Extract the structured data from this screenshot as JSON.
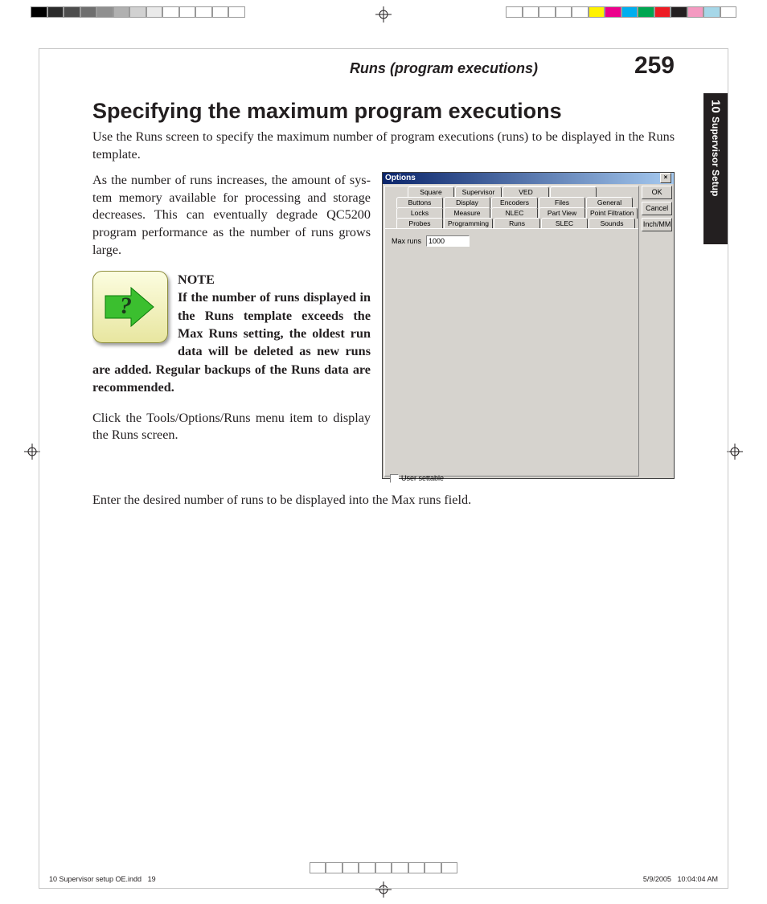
{
  "header": {
    "section": "Runs (program executions)",
    "page": "259"
  },
  "title": "Specifying the maximum program executions",
  "para1": "Use the Runs screen to specify the maximum number of program executions (runs) to be displayed in the Runs template.",
  "para2": "As the number of runs increases, the amount of sys­tem memory available for processing and storage decreases. This can eventually degrade QC5200 program performance as the number of runs grows large.",
  "note": {
    "label": "NOTE",
    "body": "If the number of runs displayed in the Runs template exceeds the Max Runs setting, the oldest run data will be deleted as new runs are added. Regular backups of the Runs data are recommended."
  },
  "para3": "Click the Tools/Options/Runs menu item to display the Runs screen.",
  "para4": "Enter the desired number of runs to be displayed into the Max runs field.",
  "side": {
    "number": "10",
    "name": "Supervisor Setup"
  },
  "dialog": {
    "title": "Options",
    "tabs_row1": [
      "Square",
      "Supervisor",
      "VED",
      ""
    ],
    "tabs_row2": [
      "Buttons",
      "Display",
      "Encoders",
      "Files",
      "General"
    ],
    "tabs_row3": [
      "Locks",
      "Measure",
      "NLEC",
      "Part View",
      "Point Filtration"
    ],
    "tabs_row4": [
      "Probes",
      "Programming",
      "Runs",
      "SLEC",
      "Sounds"
    ],
    "field_label": "Max runs",
    "field_value": "1000",
    "checkbox": "User settable",
    "buttons": [
      "OK",
      "Cancel",
      "Inch/MM"
    ]
  },
  "footer": {
    "left_file": "10 Supervisor setup OE.indd",
    "left_page": "19",
    "date": "5/9/2005",
    "time": "10:04:04 AM"
  },
  "colors": {
    "gray": [
      "#000000",
      "#2b2b2b",
      "#4d4d4d",
      "#6e6e6e",
      "#8f8f8f",
      "#b0b0b0",
      "#d1d1d1",
      "#eaeaea",
      "#ffffff",
      "#ffffff",
      "#ffffff",
      "#ffffff",
      "#ffffff"
    ],
    "cmyk": [
      "#ffffff",
      "#ffffff",
      "#ffffff",
      "#ffffff",
      "#ffffff",
      "#fff200",
      "#ec008c",
      "#00aeef",
      "#00a651",
      "#ed1c24",
      "#231f20",
      "#f49ac1",
      "#a6d7e8",
      "#ffffff"
    ]
  }
}
